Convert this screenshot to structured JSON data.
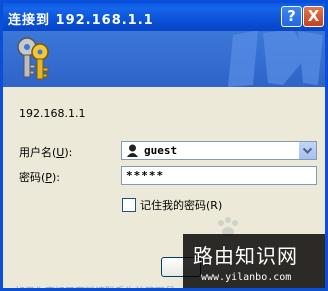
{
  "window": {
    "title": "连接到 192.168.1.1",
    "help_label": "?",
    "close_label": "X"
  },
  "dialog": {
    "host": "192.168.1.1",
    "username_label_prefix": "用户名(",
    "username_accel": "U",
    "username_label_suffix": "):",
    "username_value": "guest",
    "password_label_prefix": "密码(",
    "password_accel": "P",
    "password_label_suffix": "):",
    "password_value": "*****",
    "remember_label_prefix": "记住我的密码(",
    "remember_accel": "R",
    "remember_label_suffix": ")",
    "remember_checked": false
  },
  "footer": {
    "faded_text": "如果你忘记了密码请联系你的管理员"
  },
  "watermark": {
    "title": "路由知识网",
    "url": "www.yilanbo.com"
  },
  "colors": {
    "titlebar": "#0a52d8",
    "banner": "#3b78d8",
    "dialog_bg": "#ece9d8"
  }
}
